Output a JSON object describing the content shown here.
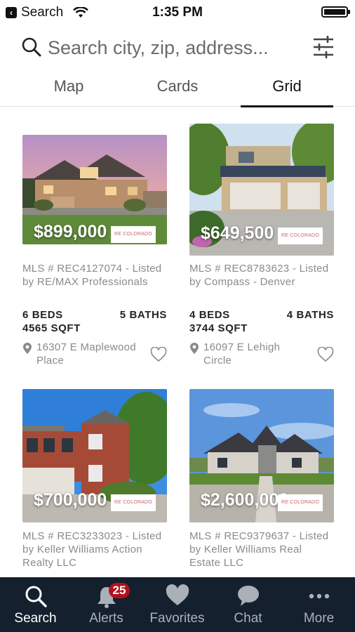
{
  "status_bar": {
    "back_label": "Search",
    "time": "1:35 PM"
  },
  "search": {
    "placeholder": "Search city, zip, address..."
  },
  "view_tabs": [
    {
      "label": "Map",
      "active": false
    },
    {
      "label": "Cards",
      "active": false
    },
    {
      "label": "Grid",
      "active": true
    }
  ],
  "listings": [
    {
      "price": "$899,000",
      "mls": "MLS # REC4127074 - Listed by RE/MAX Professionals",
      "beds": "6 BEDS",
      "baths": "5 BATHS",
      "sqft": "4565 SQFT",
      "address": "16307 E Maplewood Place",
      "logo_text": "RE COLORADO"
    },
    {
      "price": "$649,500",
      "mls": "MLS # REC8783623 - Listed by Compass - Denver",
      "beds": "4 BEDS",
      "baths": "4 BATHS",
      "sqft": "3744 SQFT",
      "address": "16097 E Lehigh Circle",
      "logo_text": "RE COLORADO"
    },
    {
      "price": "$700,000",
      "mls": "MLS # REC3233023 - Listed by Keller Williams Action Realty LLC",
      "logo_text": "RE COLORADO"
    },
    {
      "price": "$2,600,000",
      "mls": "MLS # REC9379637 - Listed by Keller Williams Real Estate LLC",
      "logo_text": "RE COLORADO"
    }
  ],
  "bottom_nav": [
    {
      "label": "Search",
      "icon": "search-icon",
      "active": true
    },
    {
      "label": "Alerts",
      "icon": "bell-icon",
      "badge": "25"
    },
    {
      "label": "Favorites",
      "icon": "heart-icon"
    },
    {
      "label": "Chat",
      "icon": "chat-bubble-icon"
    },
    {
      "label": "More",
      "icon": "more-dots-icon"
    }
  ],
  "colors": {
    "nav_background": "#14202e",
    "badge": "#b3121c",
    "active_tab_underline": "#111111"
  }
}
